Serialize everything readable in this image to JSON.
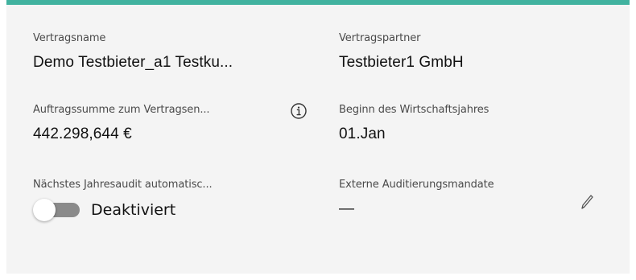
{
  "accent_color": "#41b29f",
  "fields": {
    "vertragsname": {
      "label": "Vertragsname",
      "value": "Demo Testbieter_a1 Testku..."
    },
    "vertragspartner": {
      "label": "Vertragspartner",
      "value": "Testbieter1 GmbH"
    },
    "auftragssumme": {
      "label": "Auftragssumme zum Vertragsen...",
      "value": "442.298,644 €",
      "icon": "info-icon"
    },
    "beginn": {
      "label": "Beginn des Wirtschaftsjahres",
      "value": "01.Jan"
    },
    "jahresaudit": {
      "label": "Nächstes Jahresaudit automatisc...",
      "toggle_state": false,
      "toggle_label": "Deaktiviert"
    },
    "externe": {
      "label": "Externe Auditierungsmandate",
      "value": "—",
      "icon": "pencil-icon"
    }
  }
}
